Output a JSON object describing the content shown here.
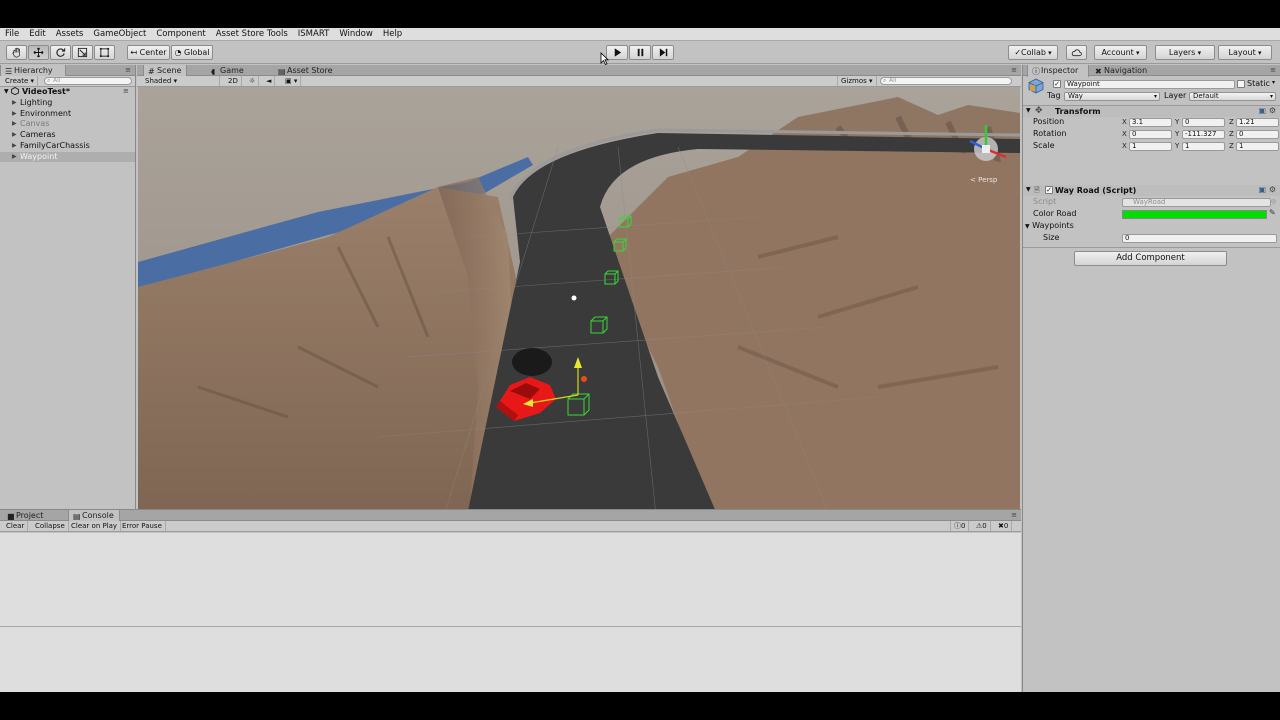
{
  "menu": [
    "File",
    "Edit",
    "Assets",
    "GameObject",
    "Component",
    "Asset Store Tools",
    "ISMART",
    "Window",
    "Help"
  ],
  "toolbar": {
    "pivot_label": "Center",
    "space_label": "Global",
    "collab_label": "Collab",
    "account_label": "Account",
    "layers_label": "Layers",
    "layout_label": "Layout"
  },
  "hierarchy": {
    "tab_label": "Hierarchy",
    "create_label": "Create",
    "search_placeholder": "All",
    "scene_name": "VideoTest*",
    "items": [
      {
        "label": "Lighting",
        "state": "normal"
      },
      {
        "label": "Environment",
        "state": "normal"
      },
      {
        "label": "Canvas",
        "state": "grey"
      },
      {
        "label": "Cameras",
        "state": "normal"
      },
      {
        "label": "FamilyCarChassis",
        "state": "normal"
      },
      {
        "label": "Waypoint",
        "state": "selected"
      }
    ]
  },
  "scene": {
    "tabs": [
      "Scene",
      "Game",
      "Asset Store"
    ],
    "shading_label": "Shaded",
    "mode_2d_label": "2D",
    "gizmos_label": "Gizmos",
    "search_placeholder": "All",
    "persp_label": "Persp",
    "colors": {
      "sky": "#a59d93",
      "terrain": "#8b715a",
      "road": "#3a3a3a",
      "water": "#4a6ea4",
      "car": "#e81818",
      "waypoint": "#38d838"
    }
  },
  "inspector": {
    "tabs": [
      "Inspector",
      "Navigation"
    ],
    "object_name": "Waypoint",
    "static_label": "Static",
    "tag_label": "Tag",
    "tag_value": "Way",
    "layer_label": "Layer",
    "layer_value": "Default",
    "transform": {
      "title": "Transform",
      "rows": [
        {
          "label": "Position",
          "x": "3.1",
          "y": "0",
          "z": "1.21"
        },
        {
          "label": "Rotation",
          "x": "0",
          "y": "-111.327",
          "z": "0"
        },
        {
          "label": "Scale",
          "x": "1",
          "y": "1",
          "z": "1"
        }
      ]
    },
    "script_component": {
      "title": "Way Road (Script)",
      "script_label": "Script",
      "script_value": "WayRoad",
      "color_road_label": "Color Road",
      "color_road_value": "#00e000",
      "waypoints_label": "Waypoints",
      "size_label": "Size",
      "size_value": "0"
    },
    "add_component_label": "Add Component"
  },
  "console": {
    "tabs": [
      "Project",
      "Console"
    ],
    "buttons": [
      "Clear",
      "Collapse",
      "Clear on Play",
      "Error Pause"
    ],
    "counts": {
      "log": "0",
      "warning": "0",
      "error": "0"
    }
  }
}
